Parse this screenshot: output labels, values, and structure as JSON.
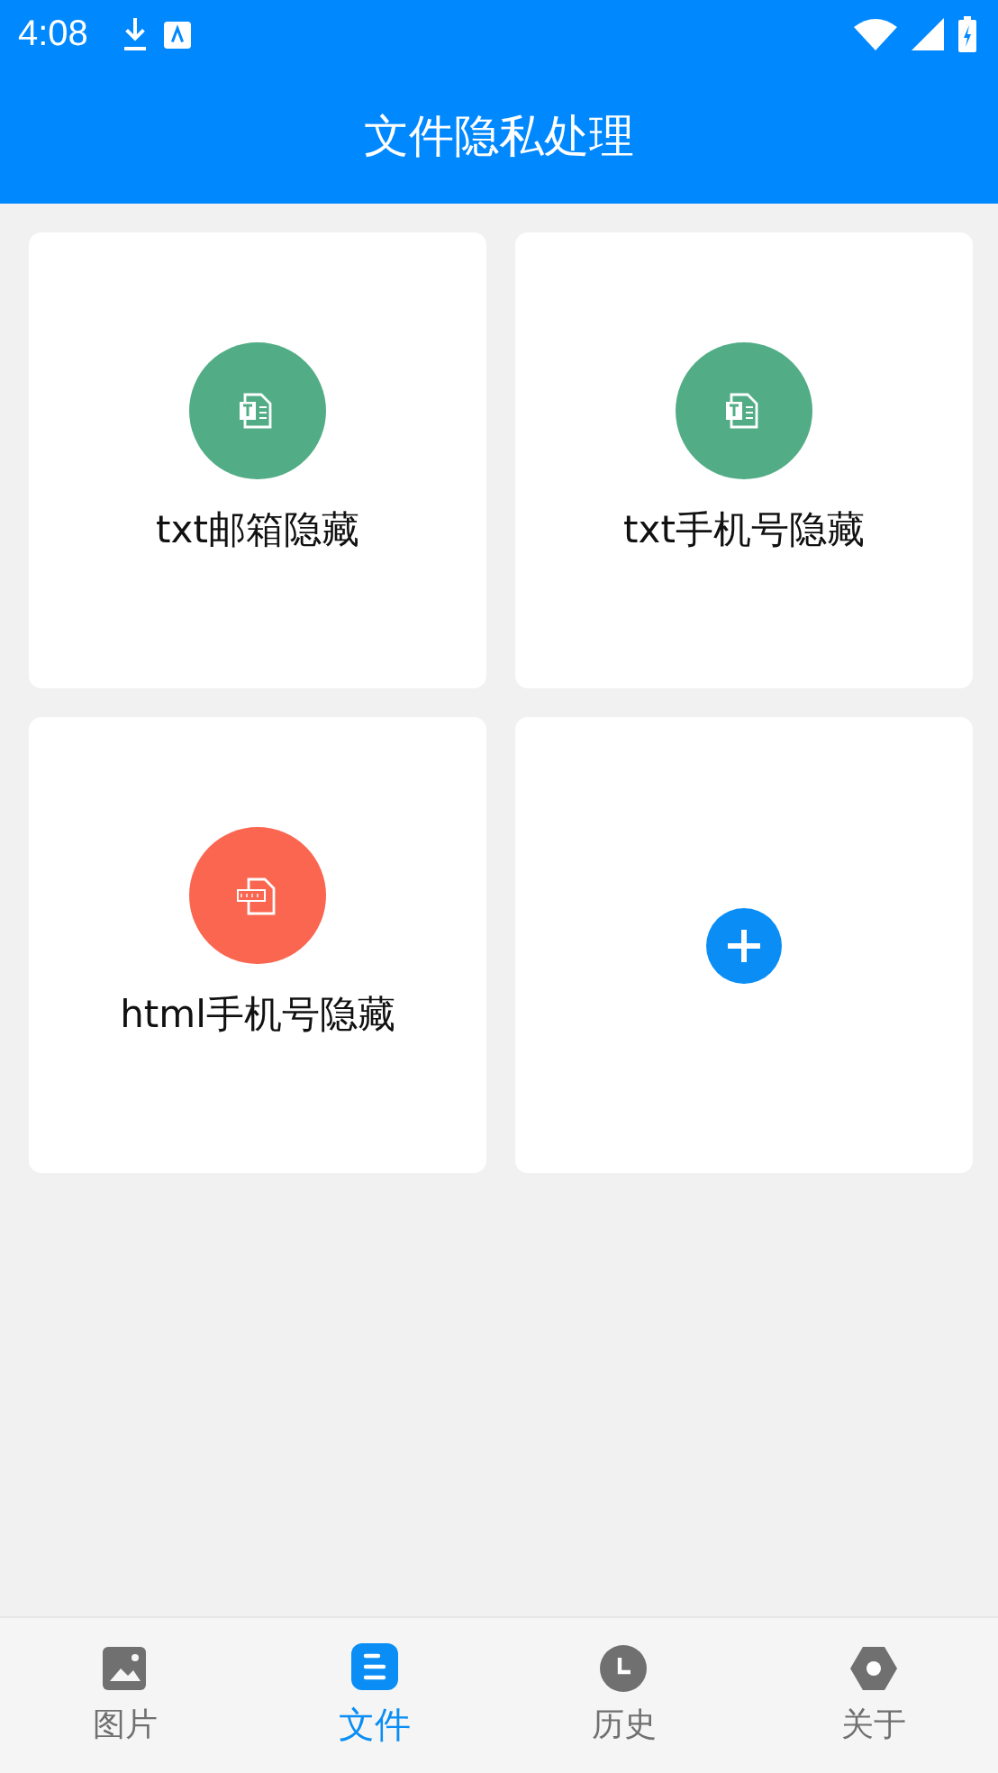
{
  "status_bar": {
    "time": "4:08"
  },
  "header": {
    "title": "文件隐私处理"
  },
  "tiles": [
    {
      "kind": "txt",
      "label": "txt邮箱隐藏",
      "color": "#52ad86"
    },
    {
      "kind": "txt",
      "label": "txt手机号隐藏",
      "color": "#52ad86"
    },
    {
      "kind": "html",
      "label": "html手机号隐藏",
      "color": "#fa6650"
    },
    {
      "kind": "add",
      "color": "#0a8ef5"
    }
  ],
  "tabs": [
    {
      "kind": "image",
      "label": "图片",
      "selected": false
    },
    {
      "kind": "file",
      "label": "文件",
      "selected": true
    },
    {
      "kind": "history",
      "label": "历史",
      "selected": false
    },
    {
      "kind": "about",
      "label": "关于",
      "selected": false
    }
  ]
}
